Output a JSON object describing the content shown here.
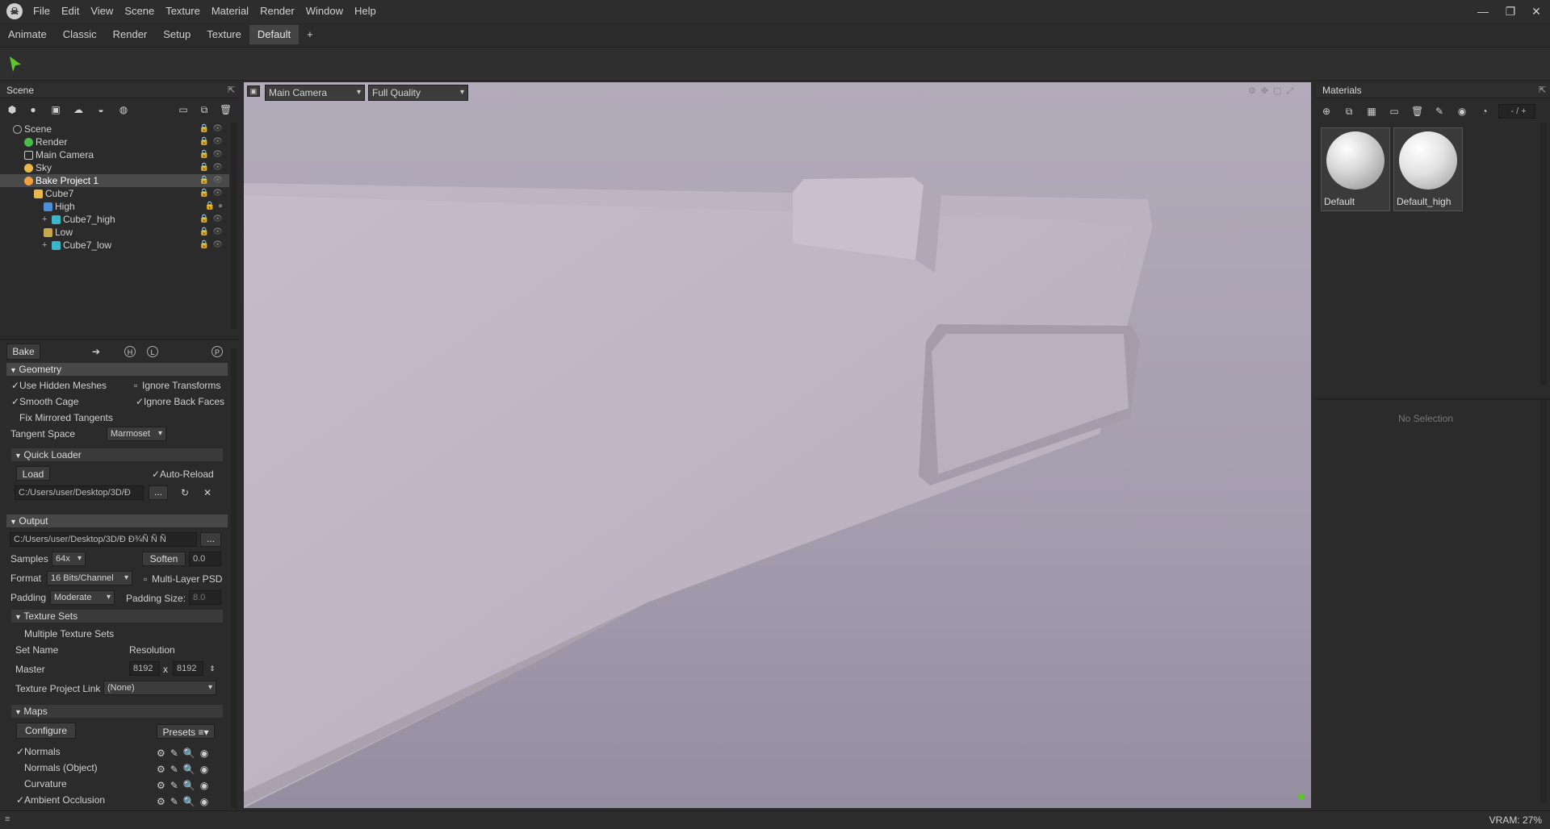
{
  "menubar": {
    "items": [
      "File",
      "Edit",
      "View",
      "Scene",
      "Texture",
      "Material",
      "Render",
      "Window",
      "Help"
    ]
  },
  "window_controls": {
    "minimize": "—",
    "restore": "❐",
    "close": "✕"
  },
  "workspace_tabs": [
    "Animate",
    "Classic",
    "Render",
    "Setup",
    "Texture",
    "Default",
    "+"
  ],
  "active_tab": "Default",
  "scene_panel": {
    "title": "Scene",
    "tree": [
      {
        "label": "Scene",
        "depth": 0,
        "icon": "scene-icon"
      },
      {
        "label": "Render",
        "depth": 1,
        "icon": "render-icon"
      },
      {
        "label": "Main Camera",
        "depth": 1,
        "icon": "camera-icon"
      },
      {
        "label": "Sky",
        "depth": 1,
        "icon": "sky-icon"
      },
      {
        "label": "Bake Project 1",
        "depth": 1,
        "icon": "bake-icon",
        "selected": true
      },
      {
        "label": "Cube7",
        "depth": 2,
        "icon": "folder-icon"
      },
      {
        "label": "High",
        "depth": 3,
        "icon": "high-group-icon"
      },
      {
        "label": "Cube7_high",
        "depth": 4,
        "icon": "mesh-icon"
      },
      {
        "label": "Low",
        "depth": 3,
        "icon": "low-group-icon"
      },
      {
        "label": "Cube7_low",
        "depth": 4,
        "icon": "mesh-icon"
      }
    ]
  },
  "bake_panel": {
    "bake_button": "Bake",
    "geometry": {
      "header": "Geometry",
      "use_hidden_meshes": "Use Hidden Meshes",
      "ignore_transforms": "Ignore Transforms",
      "smooth_cage": "Smooth Cage",
      "ignore_back_faces": "Ignore Back Faces",
      "fix_mirrored_tangents": "Fix Mirrored Tangents",
      "tangent_space_label": "Tangent Space",
      "tangent_space_value": "Marmoset"
    },
    "quick_loader": {
      "header": "Quick Loader",
      "load_button": "Load",
      "auto_reload": "Auto-Reload",
      "path": "C:/Users/user/Desktop/3D/Ð",
      "browse": "..."
    },
    "output": {
      "header": "Output",
      "path": "C:/Users/user/Desktop/3D/Ð  Ð¾Ñ  Ñ  Ñ",
      "browse": "...",
      "samples_label": "Samples",
      "samples_value": "64x",
      "soften_label": "Soften",
      "soften_value": "0.0",
      "format_label": "Format",
      "format_value": "16 Bits/Channel",
      "multilayer": "Multi-Layer PSD",
      "padding_label": "Padding",
      "padding_value": "Moderate",
      "padding_size_label": "Padding Size:",
      "padding_size_value": "8.0"
    },
    "texture_sets": {
      "header": "Texture Sets",
      "multiple": "Multiple Texture Sets",
      "set_name_col": "Set Name",
      "resolution_col": "Resolution",
      "set_name": "Master",
      "res_w": "8192",
      "res_x": "x",
      "res_h": "8192",
      "project_link_label": "Texture Project Link",
      "project_link_value": "(None)"
    },
    "maps": {
      "header": "Maps",
      "configure": "Configure",
      "presets": "Presets",
      "items": [
        {
          "label": "Normals",
          "checked": true
        },
        {
          "label": "Normals (Object)",
          "checked": false
        },
        {
          "label": "Curvature",
          "checked": false
        },
        {
          "label": "Ambient Occlusion",
          "checked": true
        }
      ]
    }
  },
  "viewport": {
    "camera": "Main Camera",
    "quality": "Full Quality"
  },
  "materials_panel": {
    "title": "Materials",
    "counter": "- / +",
    "items": [
      {
        "label": "Default"
      },
      {
        "label": "Default_high"
      }
    ],
    "no_selection": "No Selection"
  },
  "statusbar": {
    "vram": "VRAM: 27%"
  },
  "colors": {
    "accent_green": "#5ec52b",
    "selection": "#4a4a4a",
    "panel_bg": "#2b2b2b",
    "viewport_bg": "#a9a2b3"
  }
}
